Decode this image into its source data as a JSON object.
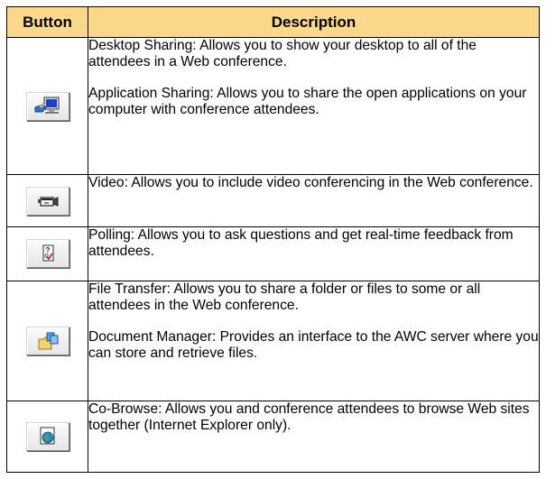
{
  "table": {
    "headers": {
      "button": "Button",
      "description": "Description"
    },
    "rows": [
      {
        "icon": "desktop-sharing-icon",
        "paragraphs": [
          "Desktop Sharing: Allows you to show your desktop to all of the attendees in a Web conference.",
          "Application Sharing: Allows you to share the open applications on your computer with conference attendees."
        ]
      },
      {
        "icon": "video-camera-icon",
        "paragraphs": [
          "Video: Allows you to include video conferencing in the Web conference."
        ]
      },
      {
        "icon": "polling-icon",
        "paragraphs": [
          "Polling: Allows you to ask questions and get real-time feedback from attendees."
        ]
      },
      {
        "icon": "file-transfer-icon",
        "paragraphs": [
          "File Transfer: Allows you to share a folder or files to some or all attendees in the Web conference.",
          "Document Manager: Provides an interface to the AWC server where you can store and retrieve files."
        ]
      },
      {
        "icon": "co-browse-icon",
        "paragraphs": [
          "Co-Browse: Allows you and conference attendees to browse Web sites together (Internet Explorer only)."
        ]
      }
    ]
  },
  "colors": {
    "header_background": "#fcd98a",
    "border": "#000000"
  }
}
